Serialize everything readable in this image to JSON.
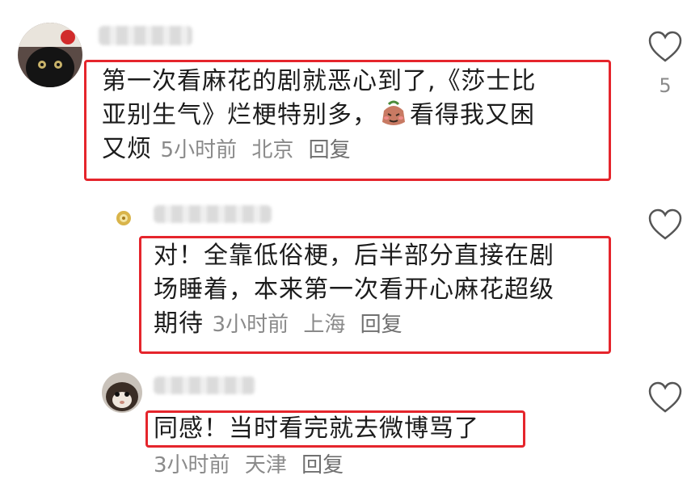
{
  "comments": [
    {
      "text_line1": "第一次看麻花的剧就恶心到了,《莎士比",
      "text_line2": "亚别生气》烂梗特别多，",
      "text_line2b": "看得我又困",
      "text_line3": "又烦",
      "time": "5小时前",
      "location": "北京",
      "reply_label": "回复",
      "like_count": "5",
      "emoji_icon": "sweaty-face-emoji"
    },
    {
      "text_line1": "对！全靠低俗梗，后半部分直接在剧",
      "text_line2": "场睡着，本来第一次看开心麻花超级",
      "text_line3": "期待",
      "time": "3小时前",
      "location": "上海",
      "reply_label": "回复"
    },
    {
      "text_line1": "同感！当时看完就去微博骂了",
      "time": "3小时前",
      "location": "天津",
      "reply_label": "回复"
    }
  ],
  "colors": {
    "highlight_box": "#e5252c",
    "meta_text": "#8a8a8a",
    "body_text": "#1c1c1c"
  },
  "icons": [
    "heart-outline-icon",
    "avatar-cat",
    "avatar-ferret",
    "avatar-small-badge"
  ]
}
